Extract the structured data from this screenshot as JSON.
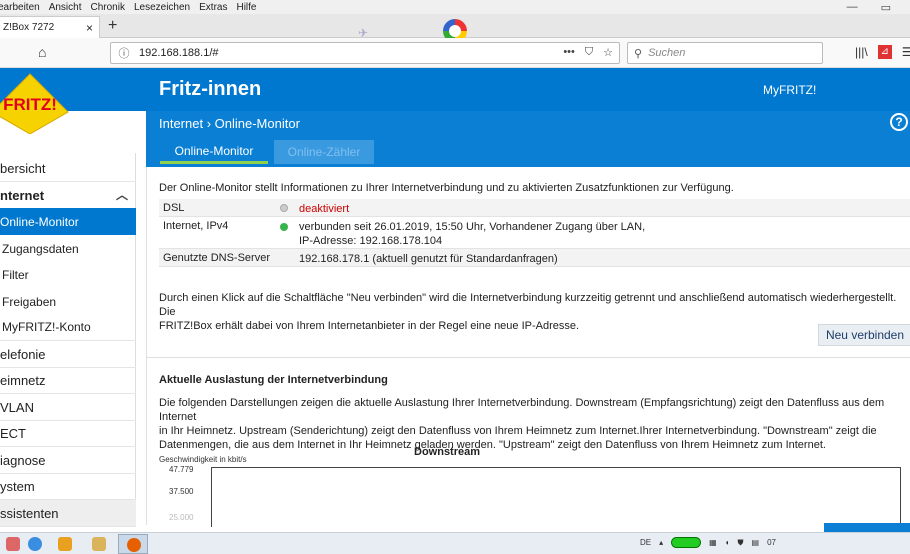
{
  "browser": {
    "menu": [
      "earbeiten",
      "Ansicht",
      "Chronik",
      "Lesezeichen",
      "Extras",
      "Hilfe"
    ],
    "tab_title": "Z!Box 7272",
    "url": "192.168.188.1/#",
    "search_placeholder": "Suchen"
  },
  "header": {
    "title": "Fritz-innen",
    "myfritz": "MyFRITZ!",
    "logo_text": "FRITZ!"
  },
  "breadcrumb": "Internet › Online-Monitor",
  "tabs": [
    {
      "label": "Online-Monitor",
      "active": true
    },
    {
      "label": "Online-Zähler",
      "active": false
    }
  ],
  "sidebar": {
    "items": [
      {
        "label": "bersicht"
      },
      {
        "label": "nternet"
      },
      {
        "label": "Online-Monitor"
      },
      {
        "label": "Zugangsdaten"
      },
      {
        "label": "Filter"
      },
      {
        "label": "Freigaben"
      },
      {
        "label": "MyFRITZ!-Konto"
      },
      {
        "label": "elefonie"
      },
      {
        "label": "eimnetz"
      },
      {
        "label": "VLAN"
      },
      {
        "label": "ECT"
      },
      {
        "label": "iagnose"
      },
      {
        "label": "ystem"
      },
      {
        "label": "ssistenten"
      }
    ]
  },
  "content": {
    "intro": "Der Online-Monitor stellt Informationen zu Ihrer Internetverbindung und zu aktivierten Zusatzfunktionen zur Verfügung.",
    "status": [
      {
        "label": "DSL",
        "value": "deaktiviert",
        "status_color": "#cccccc"
      },
      {
        "label": "Internet, IPv4",
        "value": "verbunden seit 26.01.2019, 15:50 Uhr, Vorhandener Zugang über LAN,",
        "value2": "IP-Adresse: 192.168.178.104",
        "status_color": "#36b34a"
      },
      {
        "label": "Genutzte DNS-Server",
        "value": "192.168.178.1 (aktuell genutzt für Standardanfragen)"
      }
    ],
    "reconnect_text1": "Durch einen Klick auf die Schaltfläche \"Neu verbinden\" wird die Internetverbindung kurzzeitig getrennt und anschließend automatisch wiederhergestellt. Die",
    "reconnect_text2": "FRITZ!Box erhält dabei von Ihrem Internetanbieter in der Regel eine neue IP-Adresse.",
    "reconnect_button": "Neu verbinden",
    "load_heading": "Aktuelle Auslastung der Internetverbindung",
    "load_text1": "Die folgenden Darstellungen zeigen die aktuelle Auslastung Ihrer Internetverbindung. Downstream (Empfangsrichtung) zeigt den Datenfluss aus dem Internet",
    "load_text2": "in Ihr Heimnetz. Upstream (Senderichtung) zeigt den Datenfluss von Ihrem Heimnetz zum Internet.Ihrer Internetverbindung. \"Downstream\" zeigt die",
    "load_text3": "Datenmengen, die aus dem Internet in Ihr Heimnetz geladen werden. \"Upstream\" zeigt den Datenfluss von Ihrem Heimnetz zum Internet."
  },
  "chart_data": {
    "type": "area",
    "title": "Downstream",
    "ylabel": "Geschwindigkeit in kbit/s",
    "yticks": [
      "47.779",
      "37.500",
      "25.000"
    ],
    "series": []
  },
  "taskbar": {
    "tray_lang": "DE",
    "clock": "07"
  }
}
